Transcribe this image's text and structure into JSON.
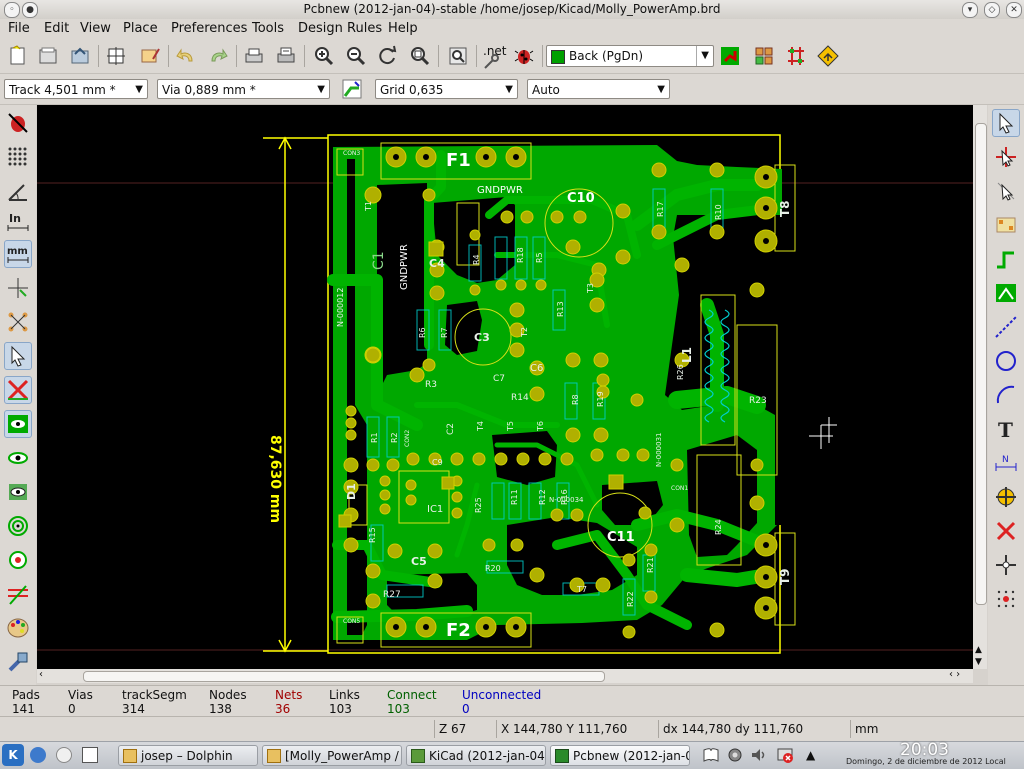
{
  "window": {
    "title": "Pcbnew (2012-jan-04)-stable /home/josep/Kicad/Molly_PowerAmp.brd"
  },
  "menu": [
    "File",
    "Edit",
    "View",
    "Place",
    "Preferences",
    "Tools",
    "Design Rules",
    "Help"
  ],
  "toolbar": {
    "net_label": ".net",
    "layer_select": "Back (PgDn)",
    "layer_color": "#00a000"
  },
  "toolbar2": {
    "track": "Track 4,501 mm *",
    "via": "Via 0,889 mm *",
    "grid": "Grid 0,635",
    "zoom": "Auto"
  },
  "board": {
    "dimension_label": "87,630 mm",
    "copper_color": "#00a800",
    "silk_color": "#d8e018",
    "edge_color": "#ffff00",
    "pad_color": "#b0b000",
    "labels": [
      "F1",
      "F2",
      "C10",
      "C11",
      "GNDPWR",
      "GNDPWR",
      "C1",
      "C4",
      "C3",
      "C7",
      "C6",
      "C9",
      "C5",
      "C2",
      "IC1",
      "D1",
      "L1",
      "T8",
      "T9",
      "R1",
      "R2",
      "R3",
      "R4",
      "R5",
      "R6",
      "R7",
      "R8",
      "R10",
      "R11",
      "R12",
      "R13",
      "R14",
      "R15",
      "R16",
      "R17",
      "R18",
      "R19",
      "R20",
      "R21",
      "R22",
      "R23",
      "R24",
      "R25",
      "R26",
      "R27",
      "N-000012",
      "N-000031",
      "N-000034",
      "CON1",
      "CON2",
      "CON3",
      "CON5",
      "T1",
      "T2",
      "T3",
      "T4",
      "T5",
      "T6",
      "T7"
    ]
  },
  "messages": {
    "pads_label": "Pads",
    "pads": "141",
    "vias_label": "Vias",
    "vias": "0",
    "tracks_label": "trackSegm",
    "tracks": "314",
    "nodes_label": "Nodes",
    "nodes": "138",
    "nets_label": "Nets",
    "nets": "36",
    "links_label": "Links",
    "links": "103",
    "connect_label": "Connect",
    "connect": "103",
    "unconnected_label": "Unconnected",
    "unconnected": "0",
    "nets_color": "#a00000",
    "connect_color": "#006000",
    "unconnected_color": "#0000c0"
  },
  "status": {
    "zoom": "Z 67",
    "xy": "X 144,780  Y 111,760",
    "dxy": "dx 144,780  dy 111,760",
    "units": "mm"
  },
  "taskbar": {
    "tasks": [
      "josep – Dolphin",
      "[Molly_PowerAmp /",
      "KiCad (2012-jan-04)",
      "Pcbnew (2012-jan-0"
    ],
    "clock": "20:03",
    "date": "Domingo, 2 de diciembre de 2012 Local"
  }
}
